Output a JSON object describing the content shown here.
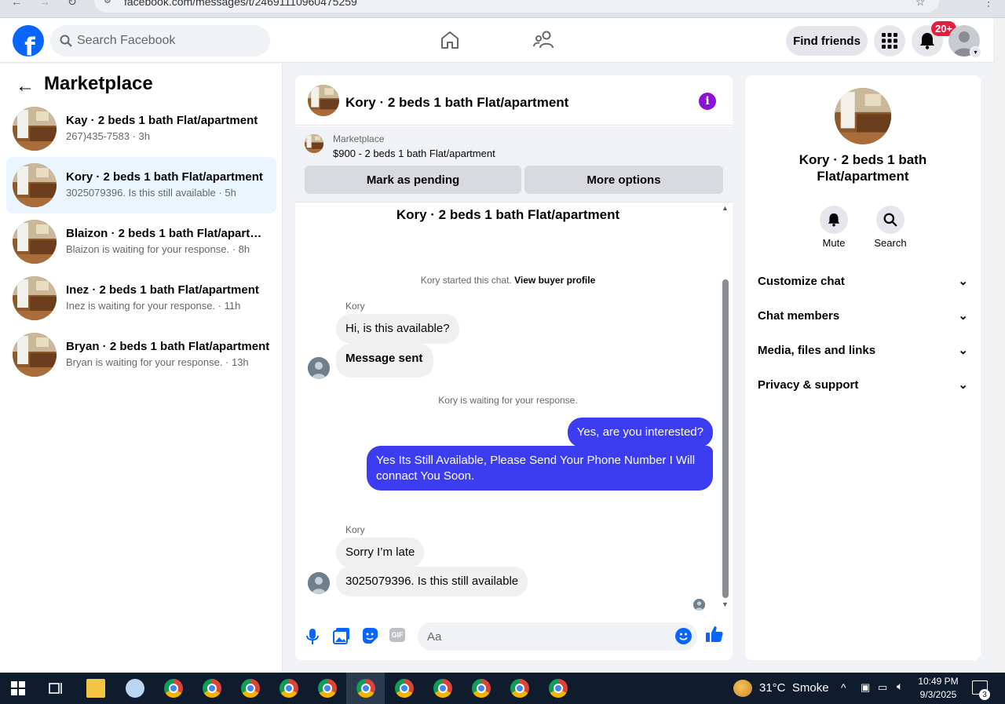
{
  "browser": {
    "url": "facebook.com/messages/t/24691110960475259"
  },
  "topbar": {
    "search_placeholder": "Search Facebook",
    "find_friends": "Find friends",
    "notification_badge": "20+"
  },
  "left": {
    "title": "Marketplace",
    "conversations": [
      {
        "name": "Kay · 2 beds 1 bath Flat/apartment",
        "snippet": "267)435-7583 · 3h",
        "active": false
      },
      {
        "name": "Kory · 2 beds 1 bath Flat/apartment",
        "snippet": "3025079396. Is this still available · 5h",
        "active": true
      },
      {
        "name": "Blaizon · 2 beds 1 bath Flat/apartm...",
        "snippet": "Blaizon is waiting for your response. · 8h",
        "active": false
      },
      {
        "name": "Inez · 2 beds 1 bath Flat/apartment",
        "snippet": "Inez is waiting for your response. · 11h",
        "active": false
      },
      {
        "name": "Bryan · 2 beds 1 bath Flat/apartment",
        "snippet": "Bryan is waiting for your response. · 13h",
        "active": false
      }
    ]
  },
  "chat": {
    "title": "Kory · 2 beds 1 bath Flat/apartment",
    "marketplace_label": "Marketplace",
    "listing": "$900 - 2 beds 1 bath Flat/apartment",
    "mark_pending": "Mark as pending",
    "more_options": "More options",
    "started_text": "Kory started this chat.",
    "view_buyer": "View buyer profile",
    "sender_name": "Kory",
    "msg1": "Hi, is this available?",
    "msg2": "Message sent",
    "waiting": "Kory is waiting for your response.",
    "out1": "Yes, are you interested?",
    "out2_line1": "Yes Its Still Available, Please Send Your Phone Number I Will",
    "out2_line2": "connact You Soon.",
    "sender_name2": "Kory",
    "msg3": "Sorry I’m late",
    "msg4": "3025079396. Is this still available",
    "input_placeholder": "Aa",
    "gif_label": "GIF"
  },
  "right": {
    "name": "Kory · 2 beds 1 bath Flat/apartment",
    "mute": "Mute",
    "search": "Search",
    "sections": [
      "Customize chat",
      "Chat members",
      "Media, files and links",
      "Privacy & support"
    ]
  },
  "taskbar": {
    "temp": "31°C",
    "weather": "Smoke",
    "time": "10:49 PM",
    "date": "9/3/2025",
    "notif_count": "3"
  },
  "colors": {
    "accent": "#0866ff",
    "outgoing_bubble": "#3c3cf0",
    "info": "#8b12d9",
    "badge": "#e41e3f"
  },
  "icons": [
    "home-icon",
    "friends-icon",
    "apps-grid-icon",
    "bell-icon",
    "info-icon",
    "mic-icon",
    "photo-icon",
    "sticker-icon",
    "gif-icon",
    "emoji-icon",
    "thumbs-up-icon",
    "search-icon",
    "chevron-down-icon",
    "back-arrow-icon"
  ]
}
